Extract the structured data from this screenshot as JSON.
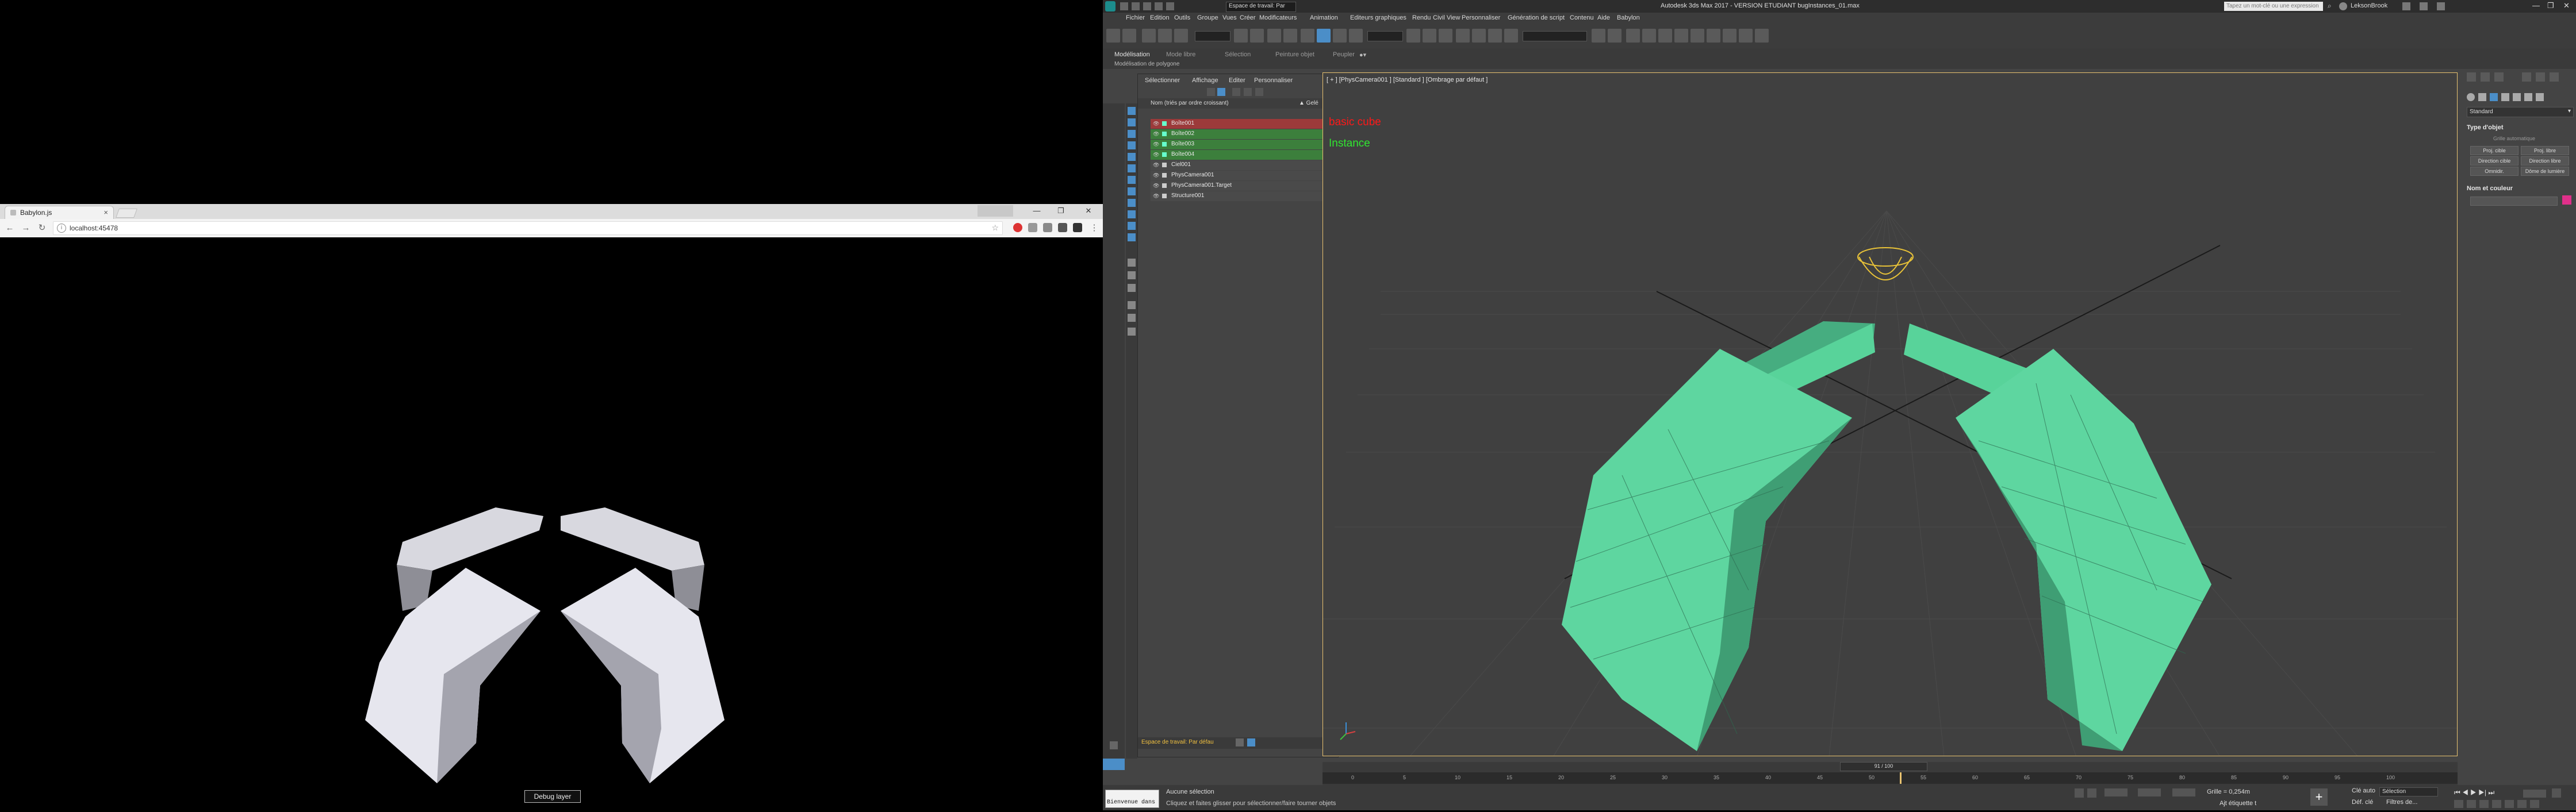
{
  "browser": {
    "tab_title": "Babylon.js",
    "tab_close": "×",
    "window_buttons": [
      "—",
      "❐",
      "✕"
    ],
    "url": "localhost:45478",
    "debug_button": "Debug layer"
  },
  "max": {
    "workspace_label": "Espace de travail: Par",
    "title": "Autodesk 3ds Max 2017 - VERSION ETUDIANT     bugInstances_01.max",
    "search_placeholder": "Tapez un mot-clé ou une expression",
    "user": "LeksonBrook",
    "menu": [
      "Fichier",
      "Edition",
      "Outils",
      "Groupe",
      "Vues",
      "Créer",
      "Modificateurs",
      "Animation",
      "Editeurs graphiques",
      "Rendu",
      "Civil View",
      "Personnaliser",
      "Génération de script",
      "Contenu",
      "Aide",
      "Babylon"
    ],
    "ribbon_tabs": [
      "Modélisation",
      "Mode libre",
      "Sélection",
      "Peinture objet",
      "Peupler"
    ],
    "ribbon_sub": "Modélisation de polygone",
    "scene_explorer": {
      "menu": [
        "Sélectionner",
        "Affichage",
        "Editer",
        "Personnaliser"
      ],
      "column_name": "Nom (triés par ordre croissant)",
      "column_frozen": "▲ Gelé",
      "rows": [
        {
          "name": "Boîte001",
          "style": "red"
        },
        {
          "name": "Boîte002",
          "style": "green"
        },
        {
          "name": "Boîte003",
          "style": "green"
        },
        {
          "name": "Boîte004",
          "style": "green"
        },
        {
          "name": "Ciel001",
          "style": "plain"
        },
        {
          "name": "PhysCamera001",
          "style": "plain"
        },
        {
          "name": "PhysCamera001.Target",
          "style": "plain"
        },
        {
          "name": "Structure001",
          "style": "plain"
        }
      ],
      "workspace_footer": "Espace de travail: Par défau"
    },
    "viewport": {
      "label": "[ + ] [PhysCamera001 ] [Standard ] [Ombrage par défaut ]",
      "annotation_red": "basic cube",
      "annotation_green": "Instance"
    },
    "command_panel": {
      "dropdown": "Standard",
      "section_object_type": "Type d'objet",
      "auto_grid": "Grille automatique",
      "buttons": [
        "Proj. cible",
        "Proj. libre",
        "Direction cible",
        "Direction libre",
        "Omnidir.",
        "Dôme de lumière"
      ],
      "section_name_color": "Nom et couleur",
      "color_swatch": "#e0308a"
    },
    "timeline": {
      "frame_label": "91 / 100",
      "ticks": [
        "0",
        "5",
        "10",
        "15",
        "20",
        "25",
        "30",
        "35",
        "40",
        "45",
        "50",
        "55",
        "60",
        "65",
        "70",
        "75",
        "80",
        "85",
        "90",
        "95",
        "100"
      ]
    },
    "status": {
      "welcome": "Bienvenue dans",
      "no_selection": "Aucune sélection",
      "hint": "Cliquez et faites glisser pour sélectionner/faire tourner objets",
      "grid": "Grille = 0,254m",
      "key_auto": "Clé auto",
      "selection": "Sélection",
      "set_key": "Déf. clé",
      "key_filters": "Filtres de...",
      "add_time_tag": "Ajt étiquette t"
    }
  },
  "colors": {
    "accent_green": "#58d39a",
    "viewport_border": "#e8c270",
    "selection_red": "#9c3a3a",
    "selection_green": "#3c7f3c"
  }
}
